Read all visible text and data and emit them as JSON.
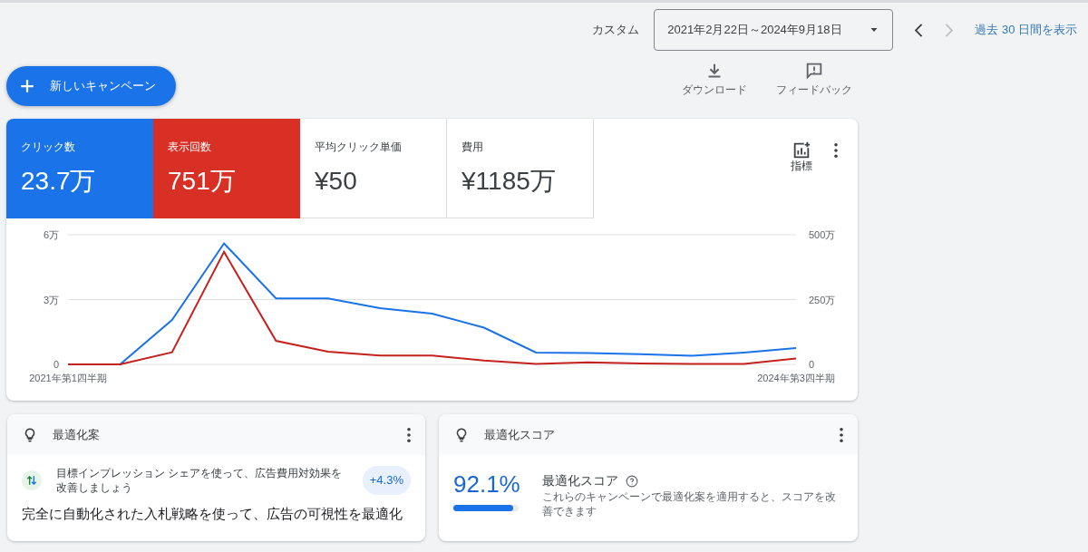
{
  "date_range": {
    "label": "カスタム",
    "value": "2021年2月22日～2024年9月18日",
    "prev_disabled": false,
    "next_disabled": true,
    "link": "過去 30 日間を表示"
  },
  "new_campaign": {
    "label": "新しいキャンペーン"
  },
  "actions": [
    {
      "kind": "download",
      "label": "ダウンロード"
    },
    {
      "kind": "feedback",
      "label": "フィードバック"
    }
  ],
  "metrics": [
    {
      "label": "クリック数",
      "value": "23.7万",
      "selected": true,
      "color": "#1a73e8"
    },
    {
      "label": "表示回数",
      "value": "751万",
      "selected": true,
      "color": "#d93025"
    },
    {
      "label": "平均クリック単価",
      "value": "¥50",
      "selected": false
    },
    {
      "label": "費用",
      "value": "¥1185万",
      "selected": false
    }
  ],
  "metrics_button": {
    "label": "指標"
  },
  "chart_data": {
    "type": "line",
    "categories": [
      "2021年第1四半期",
      null,
      null,
      null,
      null,
      null,
      null,
      null,
      null,
      null,
      null,
      null,
      null,
      null,
      "2024年第3四半期"
    ],
    "ylim": [
      0,
      6
    ],
    "yticks": [
      {
        "value": 0,
        "label": "0"
      },
      {
        "value": 3,
        "label": "3万"
      },
      {
        "value": 6,
        "label": "6万"
      }
    ],
    "y2lim": [
      0,
      500
    ],
    "y2ticks": [
      {
        "value": 0,
        "label": "0"
      },
      {
        "value": 250,
        "label": "250万"
      },
      {
        "value": 500,
        "label": "500万"
      }
    ],
    "series": [
      {
        "color": "#1a73e8",
        "values": [
          0,
          0,
          2.05,
          5.6,
          3.05,
          3.05,
          2.6,
          2.35,
          1.7,
          0.55,
          0.52,
          0.47,
          0.4,
          0.55,
          0.75
        ]
      },
      {
        "color": "#c5221f",
        "axis": "y2",
        "values": [
          0,
          0,
          47,
          434,
          91,
          49,
          34,
          34,
          15,
          2,
          8,
          4,
          2,
          2,
          23
        ]
      }
    ]
  },
  "recommendations": {
    "title": "最適化案",
    "items": [
      {
        "text": "目標インプレッション シェアを使って、広告費用対効果を改善しましょう",
        "badge": "+4.3%"
      }
    ],
    "headline": "完全に自動化された入札戦略を使って、広告の可視性を最適化"
  },
  "score": {
    "title": "最適化スコア",
    "value": "92.1%",
    "level": 0.921,
    "heading": "最適化スコア",
    "description": "これらのキャンペーンで最適化案を適用すると、スコアを改善できます"
  }
}
